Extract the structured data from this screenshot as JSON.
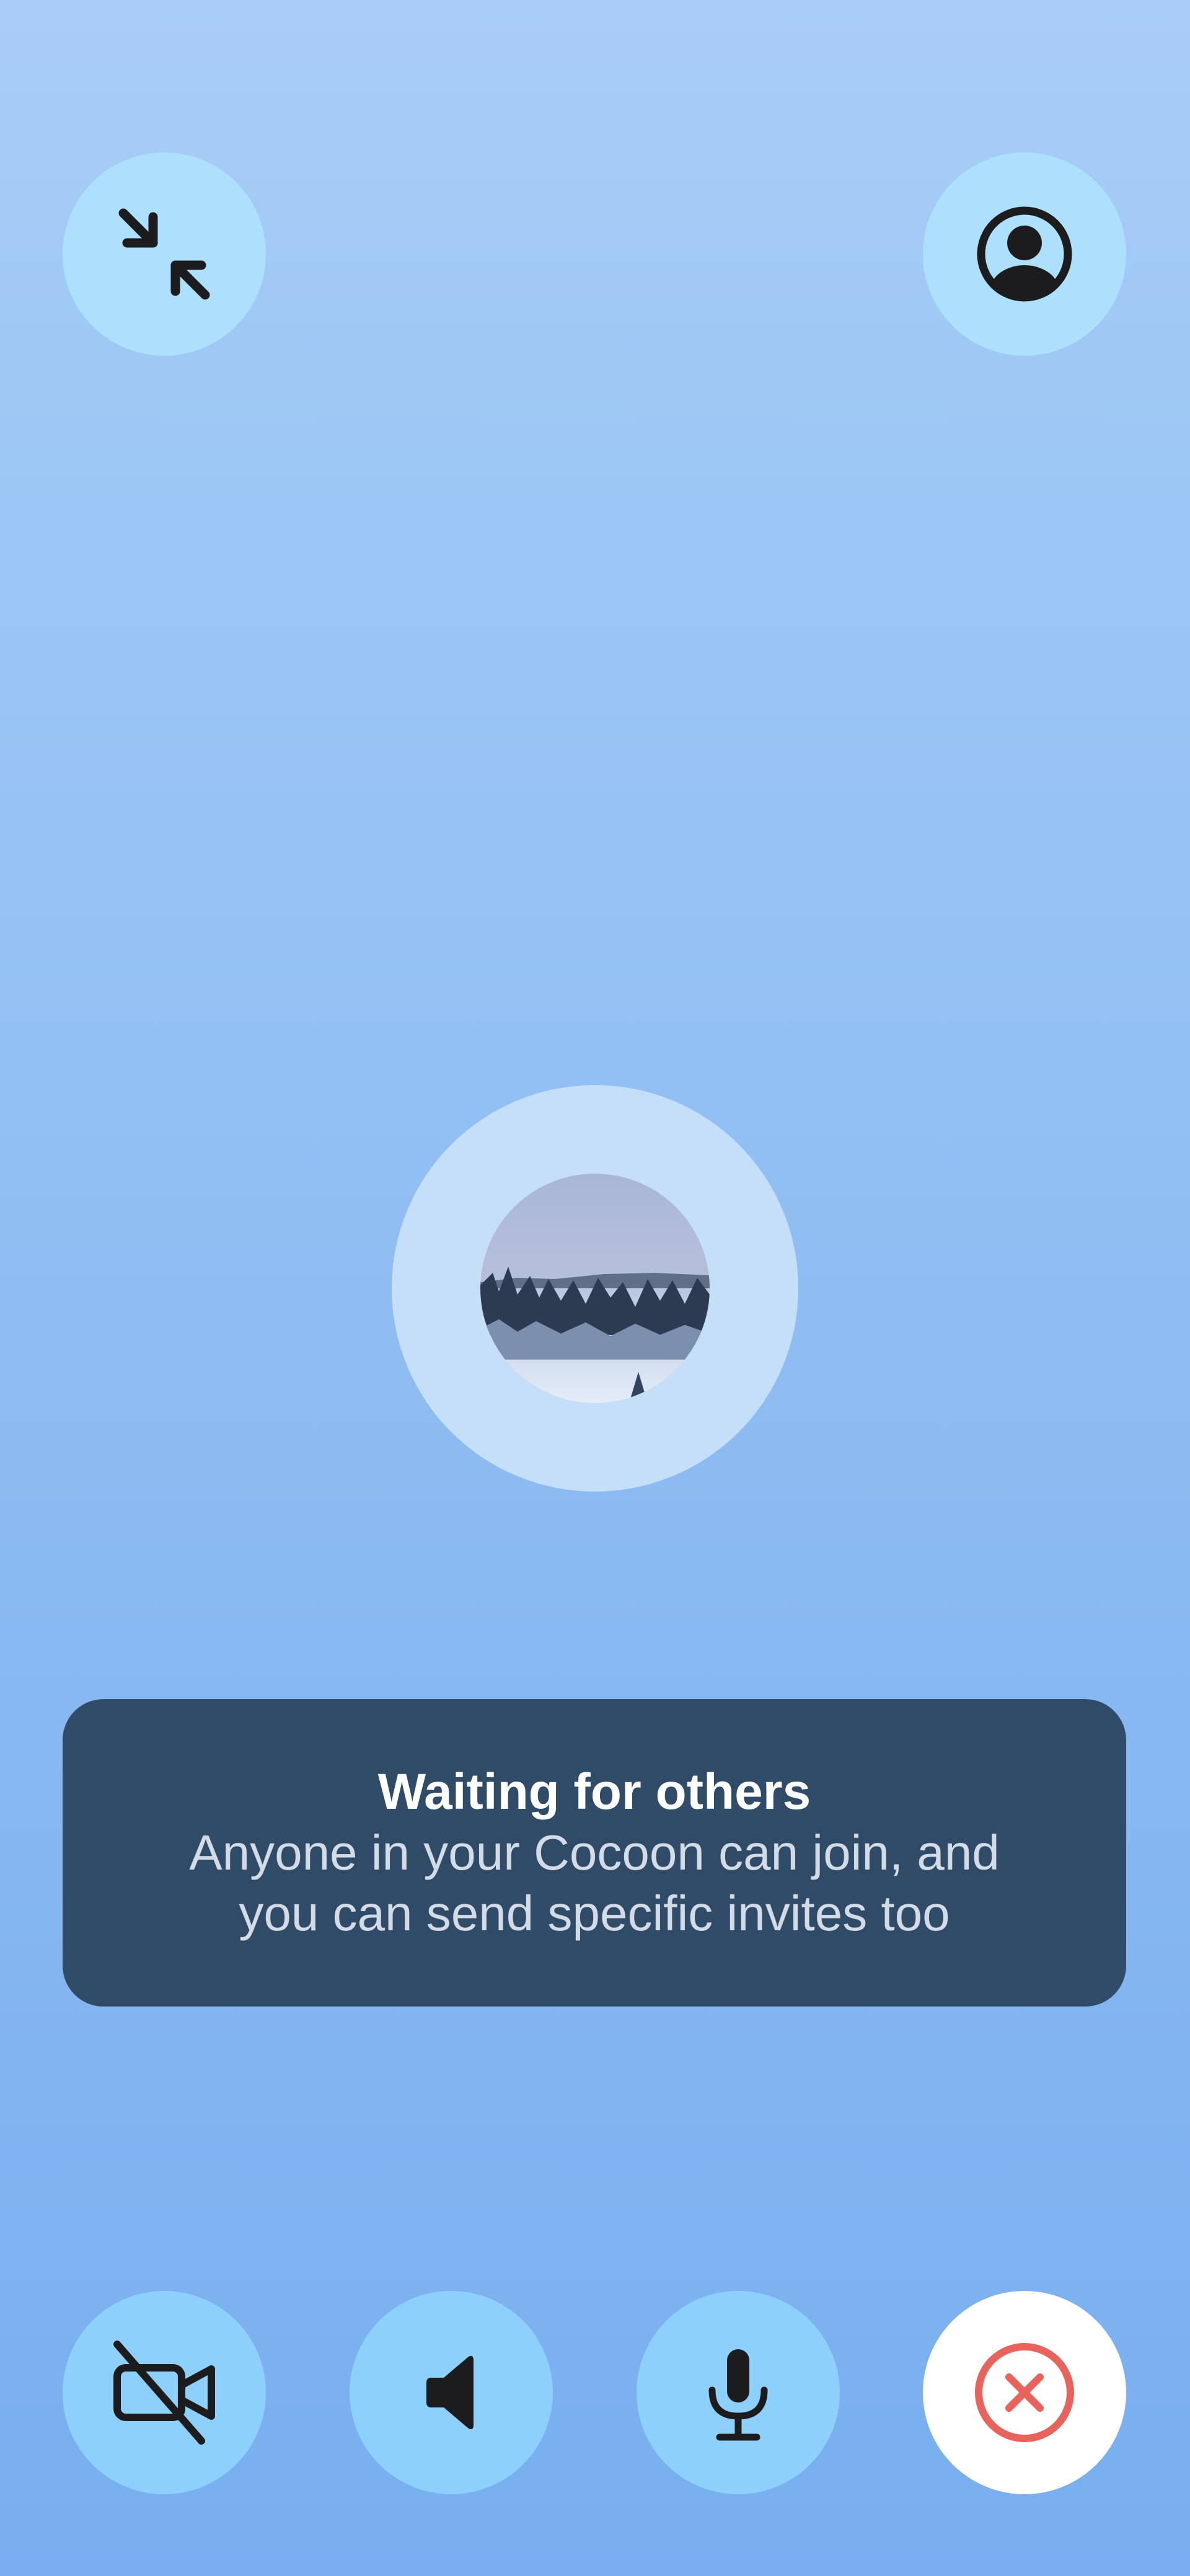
{
  "call": {
    "status_title": "Waiting for others",
    "status_message": "Anyone in your Cocoon can join, and you can send specific invites too"
  },
  "colors": {
    "background_top": "#a9cdf6",
    "background_bottom": "#78aeef",
    "top_button": "#ade0fd",
    "bottom_button": "#8dd0fc",
    "banner": "#304b67",
    "end_call_icon": "#e8635c"
  },
  "icons": {
    "collapse": "collapse-arrows-icon",
    "profile": "user-circle-icon",
    "camera": "video-off-icon",
    "speaker": "speaker-icon",
    "mic": "microphone-icon",
    "end": "close-circle-icon"
  }
}
